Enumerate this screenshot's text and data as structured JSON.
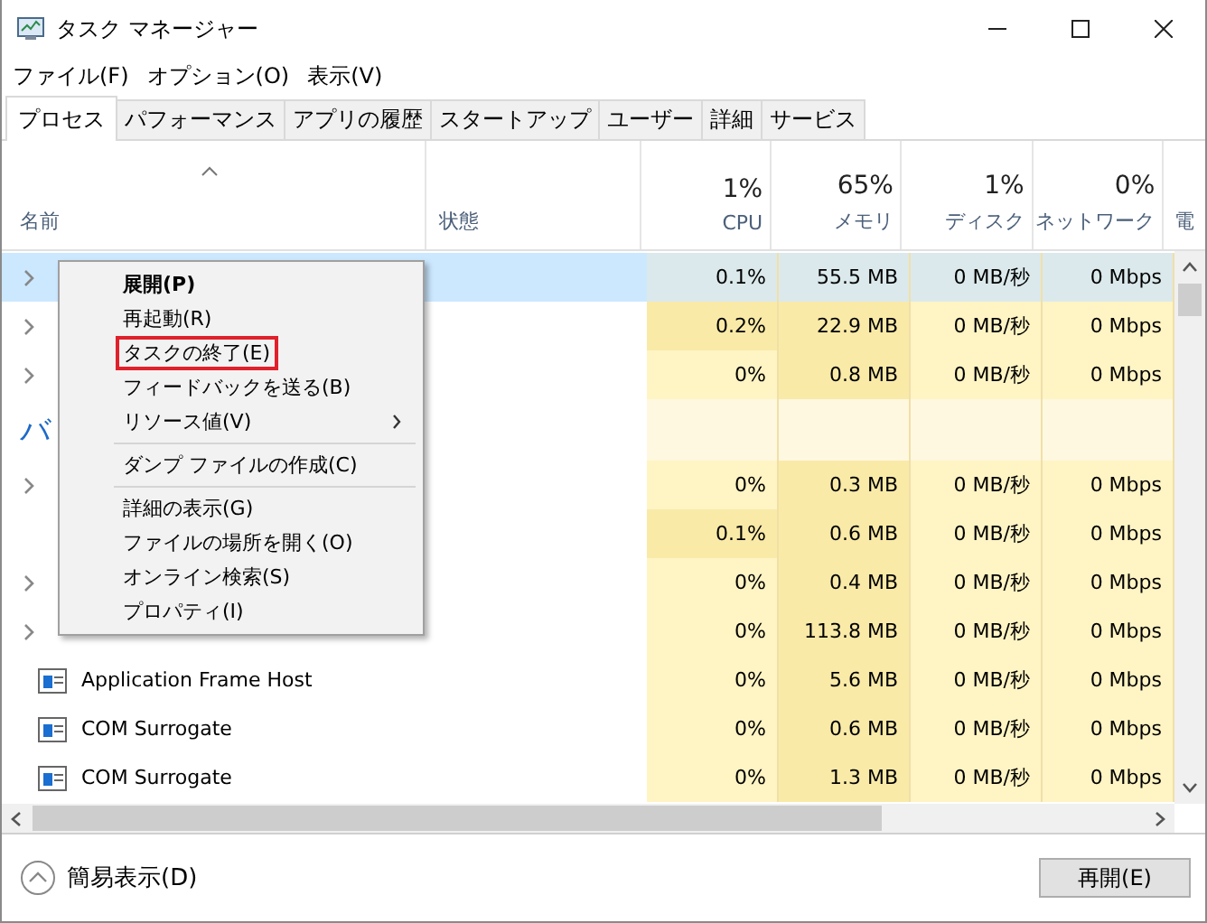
{
  "window": {
    "title": "タスク マネージャー"
  },
  "menu_bar": [
    "ファイル(F)",
    "オプション(O)",
    "表示(V)"
  ],
  "tabs": [
    {
      "label": "プロセス",
      "selected": true
    },
    {
      "label": "パフォーマンス",
      "selected": false
    },
    {
      "label": "アプリの履歴",
      "selected": false
    },
    {
      "label": "スタートアップ",
      "selected": false
    },
    {
      "label": "ユーザー",
      "selected": false
    },
    {
      "label": "詳細",
      "selected": false
    },
    {
      "label": "サービス",
      "selected": false
    }
  ],
  "table": {
    "name_column": "名前",
    "status_column": "状態",
    "columns": [
      {
        "total": "1%",
        "label": "CPU"
      },
      {
        "total": "65%",
        "label": "メモリ"
      },
      {
        "total": "1%",
        "label": "ディスク"
      },
      {
        "total": "0%",
        "label": "ネットワーク"
      }
    ],
    "column_7": "電",
    "rows": [
      {
        "kind": "expandable",
        "selected": true,
        "values": [
          {
            "text": "0.1%",
            "hot": false
          },
          {
            "text": "55.5 MB",
            "hot": false
          },
          {
            "text": "0 MB/秒",
            "hot": false
          },
          {
            "text": "0 Mbps",
            "hot": false
          }
        ]
      },
      {
        "kind": "expandable",
        "selected": false,
        "values": [
          {
            "text": "0.2%",
            "hot": true
          },
          {
            "text": "22.9 MB",
            "hot": true
          },
          {
            "text": "0 MB/秒",
            "hot": false
          },
          {
            "text": "0 Mbps",
            "hot": false
          }
        ]
      },
      {
        "kind": "expandable",
        "selected": false,
        "values": [
          {
            "text": "0%",
            "hot": false
          },
          {
            "text": "0.8 MB",
            "hot": true
          },
          {
            "text": "0 MB/秒",
            "hot": false
          },
          {
            "text": "0 Mbps",
            "hot": false
          }
        ]
      },
      {
        "kind": "group",
        "title": "バ"
      },
      {
        "kind": "expandable",
        "selected": false,
        "values": [
          {
            "text": "0%",
            "hot": false
          },
          {
            "text": "0.3 MB",
            "hot": true
          },
          {
            "text": "0 MB/秒",
            "hot": false
          },
          {
            "text": "0 Mbps",
            "hot": false
          }
        ]
      },
      {
        "kind": "single",
        "selected": false,
        "values": [
          {
            "text": "0.1%",
            "hot": true
          },
          {
            "text": "0.6 MB",
            "hot": true
          },
          {
            "text": "0 MB/秒",
            "hot": false
          },
          {
            "text": "0 Mbps",
            "hot": false
          }
        ]
      },
      {
        "kind": "expandable",
        "selected": false,
        "values": [
          {
            "text": "0%",
            "hot": false
          },
          {
            "text": "0.4 MB",
            "hot": true
          },
          {
            "text": "0 MB/秒",
            "hot": false
          },
          {
            "text": "0 Mbps",
            "hot": false
          }
        ]
      },
      {
        "kind": "expandable",
        "selected": false,
        "values": [
          {
            "text": "0%",
            "hot": false
          },
          {
            "text": "113.8 MB",
            "hot": true
          },
          {
            "text": "0 MB/秒",
            "hot": false
          },
          {
            "text": "0 Mbps",
            "hot": false
          }
        ]
      },
      {
        "kind": "single",
        "selected": false,
        "name": "Application Frame Host",
        "values": [
          {
            "text": "0%",
            "hot": false
          },
          {
            "text": "5.6 MB",
            "hot": true
          },
          {
            "text": "0 MB/秒",
            "hot": false
          },
          {
            "text": "0 Mbps",
            "hot": false
          }
        ]
      },
      {
        "kind": "single",
        "selected": false,
        "name": "COM Surrogate",
        "values": [
          {
            "text": "0%",
            "hot": false
          },
          {
            "text": "0.6 MB",
            "hot": true
          },
          {
            "text": "0 MB/秒",
            "hot": false
          },
          {
            "text": "0 Mbps",
            "hot": false
          }
        ]
      },
      {
        "kind": "single",
        "selected": false,
        "name": "COM Surrogate",
        "values": [
          {
            "text": "0%",
            "hot": false
          },
          {
            "text": "1.3 MB",
            "hot": true
          },
          {
            "text": "0 MB/秒",
            "hot": false
          },
          {
            "text": "0 Mbps",
            "hot": false
          }
        ]
      }
    ]
  },
  "context_menu": [
    {
      "kind": "command",
      "label": "展開(P)",
      "default": true,
      "highlighted": false
    },
    {
      "kind": "command",
      "label": "再起動(R)",
      "default": false,
      "highlighted": false
    },
    {
      "kind": "command",
      "label": "タスクの終了(E)",
      "default": false,
      "highlighted": true
    },
    {
      "kind": "command",
      "label": "フィードバックを送る(B)",
      "default": false,
      "highlighted": false
    },
    {
      "kind": "submenu",
      "label": "リソース値(V)",
      "default": false,
      "highlighted": false
    },
    {
      "kind": "separator"
    },
    {
      "kind": "command",
      "label": "ダンプ ファイルの作成(C)",
      "default": false,
      "highlighted": false
    },
    {
      "kind": "separator"
    },
    {
      "kind": "command",
      "label": "詳細の表示(G)",
      "default": false,
      "highlighted": false
    },
    {
      "kind": "command",
      "label": "ファイルの場所を開く(O)",
      "default": false,
      "highlighted": false
    },
    {
      "kind": "command",
      "label": "オンライン検索(S)",
      "default": false,
      "highlighted": false
    },
    {
      "kind": "command",
      "label": "プロパティ(I)",
      "default": false,
      "highlighted": false
    }
  ],
  "footer": {
    "toggle": "簡易表示(D)",
    "button": "再開(E)"
  }
}
